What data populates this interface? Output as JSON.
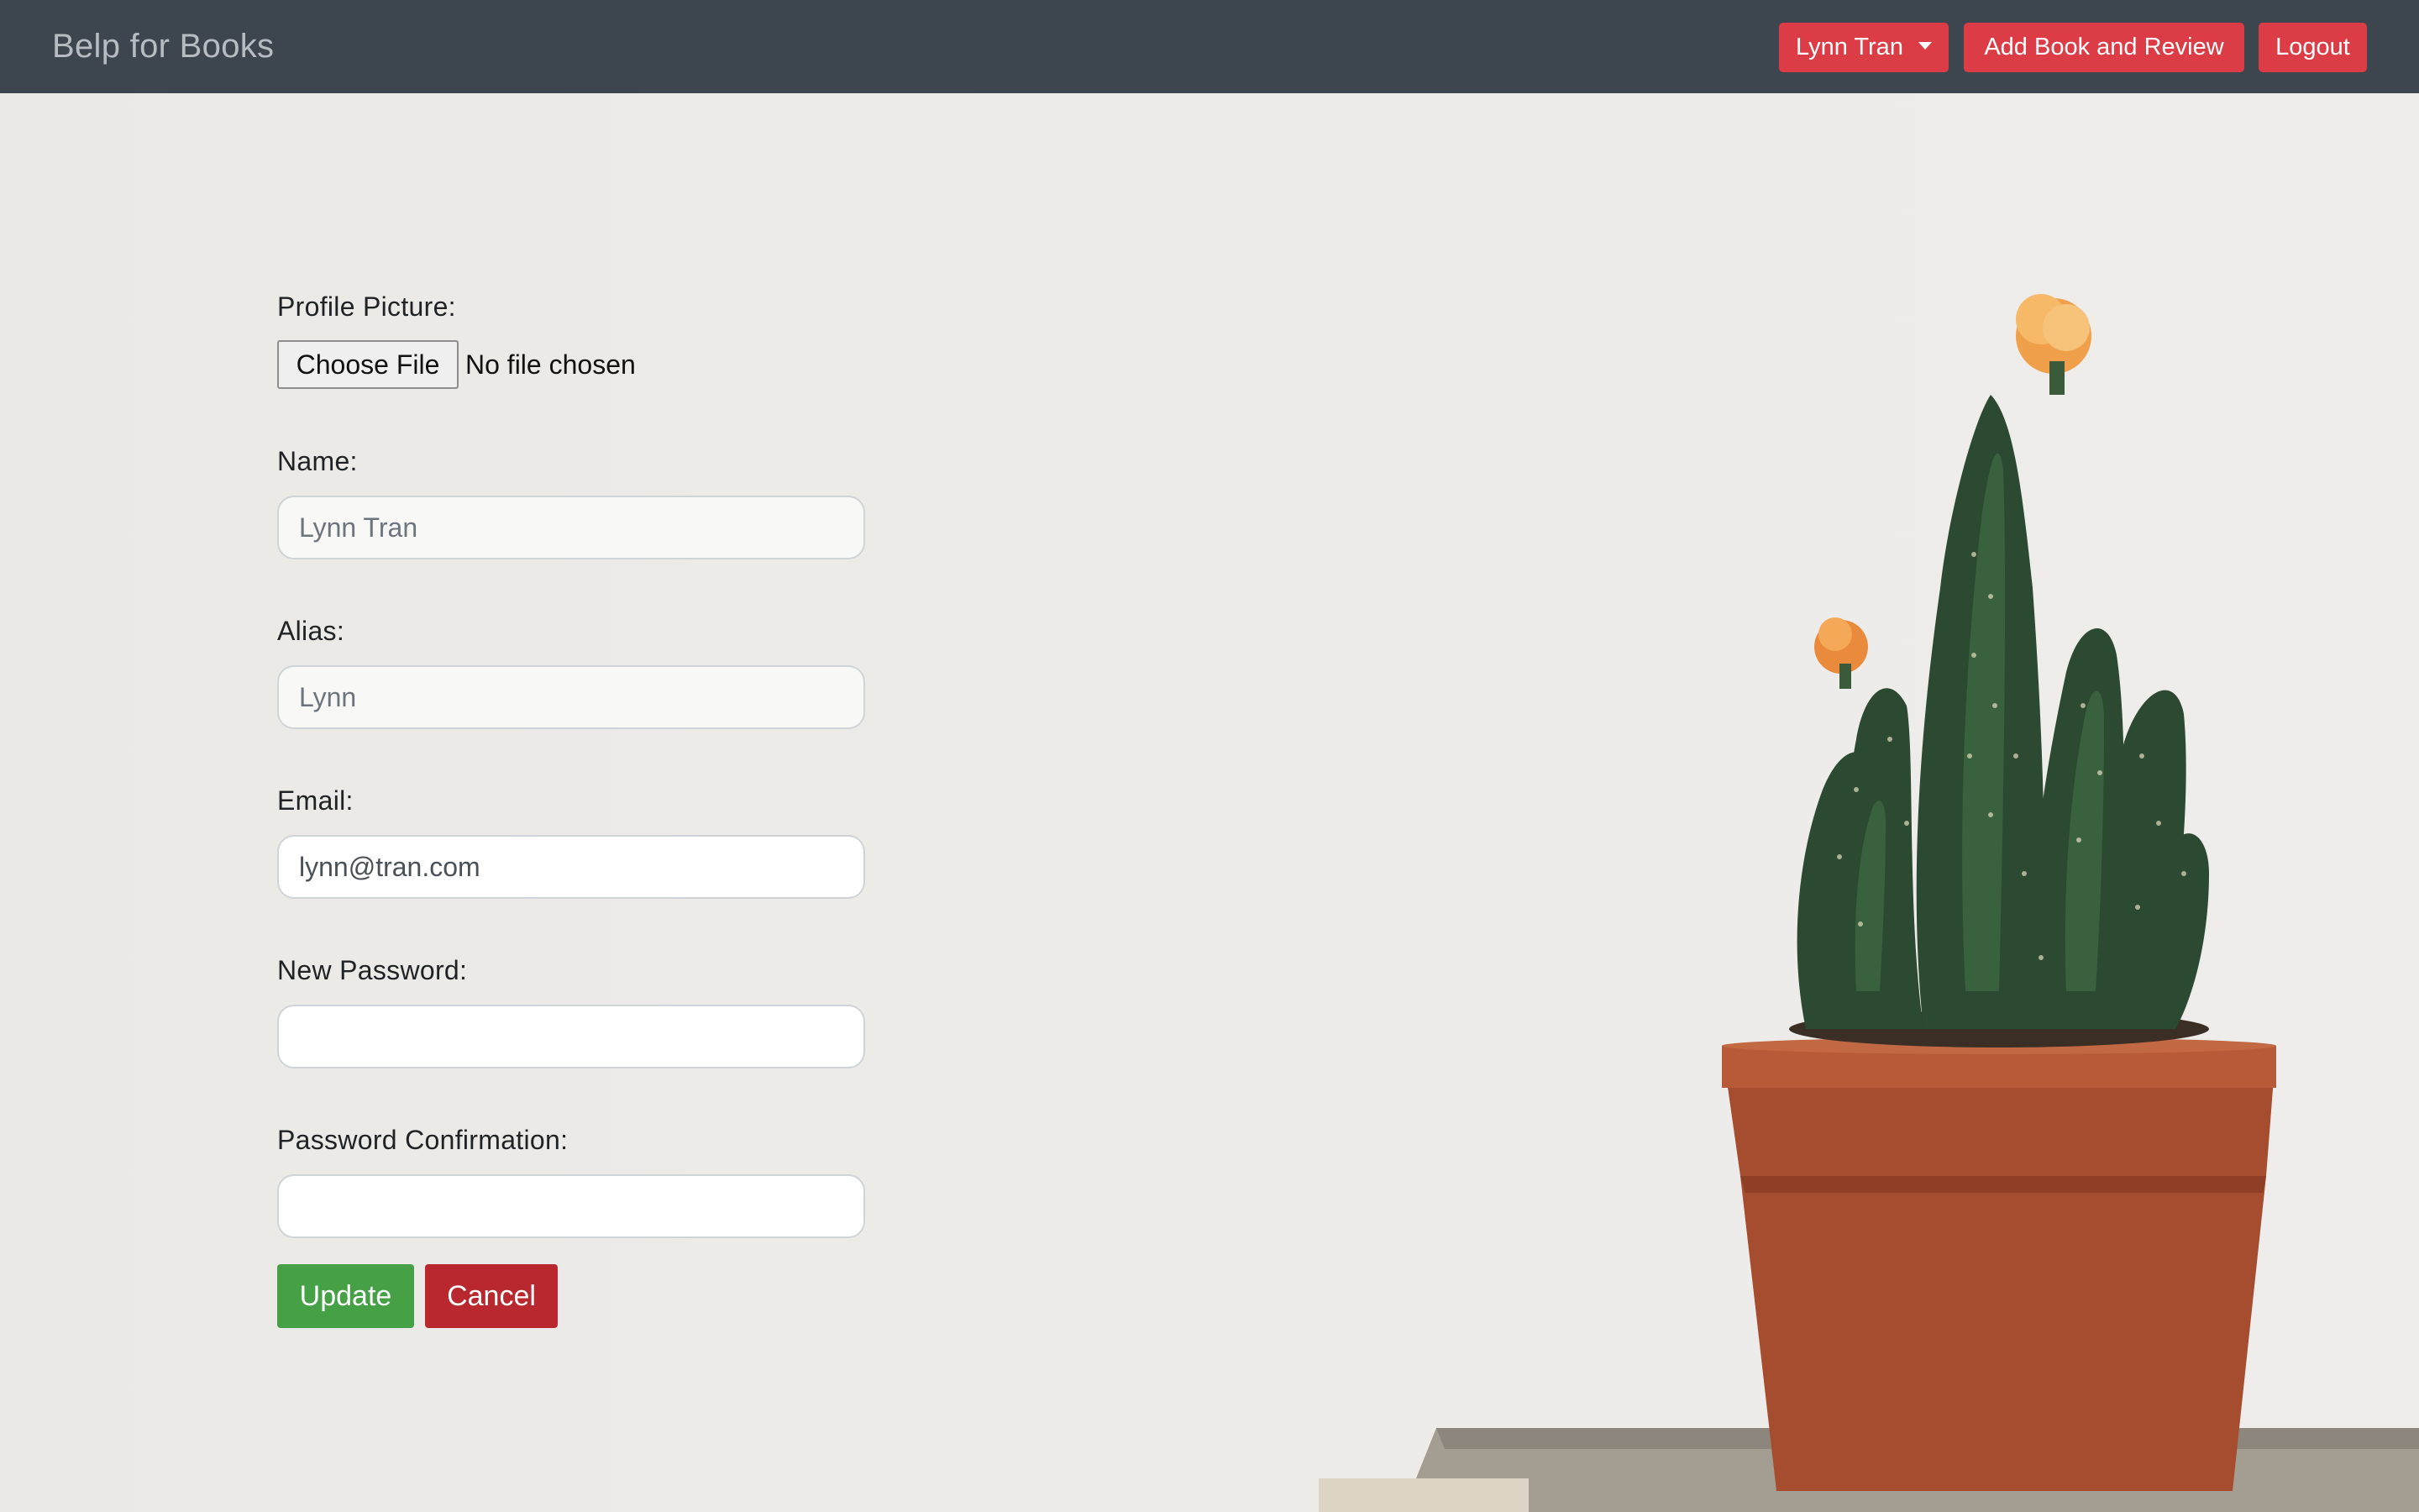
{
  "navbar": {
    "brand": "Belp for Books",
    "user_menu_label": "Lynn Tran",
    "add_book_label": "Add Book and Review",
    "logout_label": "Logout"
  },
  "form": {
    "profile_picture_label": "Profile Picture:",
    "file_button_label": "Choose File",
    "file_status": "No file chosen",
    "name_label": "Name:",
    "name_placeholder": "Lynn Tran",
    "alias_label": "Alias:",
    "alias_placeholder": "Lynn",
    "email_label": "Email:",
    "email_value": "lynn@tran.com",
    "new_password_label": "New Password:",
    "new_password_value": "",
    "password_confirmation_label": "Password Confirmation:",
    "password_confirmation_value": "",
    "update_label": "Update",
    "cancel_label": "Cancel"
  },
  "colors": {
    "navbar_bg": "#3d464f",
    "nav_button": "#dc3c45",
    "update_button": "#45a046",
    "cancel_button": "#b9272f"
  },
  "icons": [
    "caret-down-icon",
    "cactus-decoration"
  ]
}
